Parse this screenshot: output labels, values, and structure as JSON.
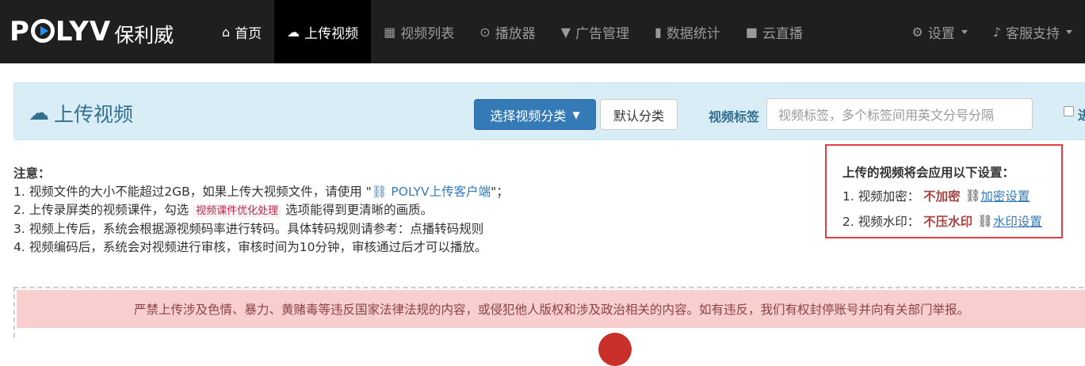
{
  "brand": {
    "logo_text_a": "P",
    "logo_text_b": "LYV",
    "logo_cn": "保利威"
  },
  "nav": {
    "items": [
      {
        "label": "首页",
        "icon": "home-icon"
      },
      {
        "label": "上传视频",
        "icon": "cloud-upload-icon"
      },
      {
        "label": "视频列表",
        "icon": "film-icon"
      },
      {
        "label": "播放器",
        "icon": "play-circle-icon"
      },
      {
        "label": "广告管理",
        "icon": "filter-icon"
      },
      {
        "label": "数据统计",
        "icon": "bar-chart-icon"
      },
      {
        "label": "云直播",
        "icon": "video-camera-icon"
      }
    ],
    "settings_label": "设置",
    "support_label": "客服支持"
  },
  "upload_panel": {
    "title": "上传视频",
    "category_button": "选择视频分类",
    "default_button": "默认分类",
    "tag_label": "视频标签",
    "tag_placeholder": "视频标签，多个标签间用英文分号分隔",
    "checkbox_label": "进"
  },
  "notes": {
    "title": "注意：",
    "line1_pre": "1. 视频文件的大小不能超过2GB，如果上传大视频文件，请使用 \"",
    "line1_link": "POLYV上传客户端",
    "line1_post": "\"；",
    "line2_pre": "2. 上传录屏类的视频课件，勾选 ",
    "line2_code": "视频课件优化处理",
    "line2_post": " 选项能得到更清晰的画质。",
    "line3": "3. 视频上传后，系统会根据源视频码率进行转码。具体转码规则请参考：点播转码规则",
    "line4": "4. 视频编码后，系统会对视频进行审核，审核时间为10分钟，审核通过后才可以播放。"
  },
  "settings_box": {
    "heading": "上传的视频将会应用以下设置：",
    "encrypt_label": "1. 视频加密：",
    "encrypt_value": "不加密",
    "encrypt_link": "加密设置",
    "watermark_label": "2. 视频水印：",
    "watermark_value": "不压水印",
    "watermark_link": "水印设置"
  },
  "warning": "严禁上传涉及色情、暴力、黄赌毒等违反国家法律法规的内容，或侵犯他人版权和涉及政治相关的内容。如有违反，我们有权封停账号并向有关部门举报。"
}
